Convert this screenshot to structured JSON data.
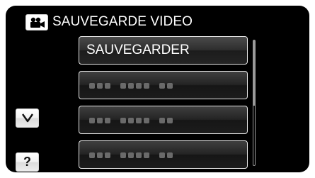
{
  "header": {
    "mode_icon": "video-camera-icon",
    "title": "SAUVEGARDE VIDEO"
  },
  "menu": {
    "items": [
      {
        "label": "SAUVEGARDER",
        "state": "selected"
      },
      {
        "label": "",
        "state": "unavailable"
      },
      {
        "label": "",
        "state": "unavailable"
      },
      {
        "label": "",
        "state": "unavailable"
      }
    ]
  },
  "side_buttons": {
    "down_icon": "chevron-down-icon",
    "help_label": "?"
  },
  "colors": {
    "background": "#000000",
    "text": "#ffffff",
    "button_border": "#e6e6e6",
    "placeholder_dots": "#6a6a6a"
  }
}
